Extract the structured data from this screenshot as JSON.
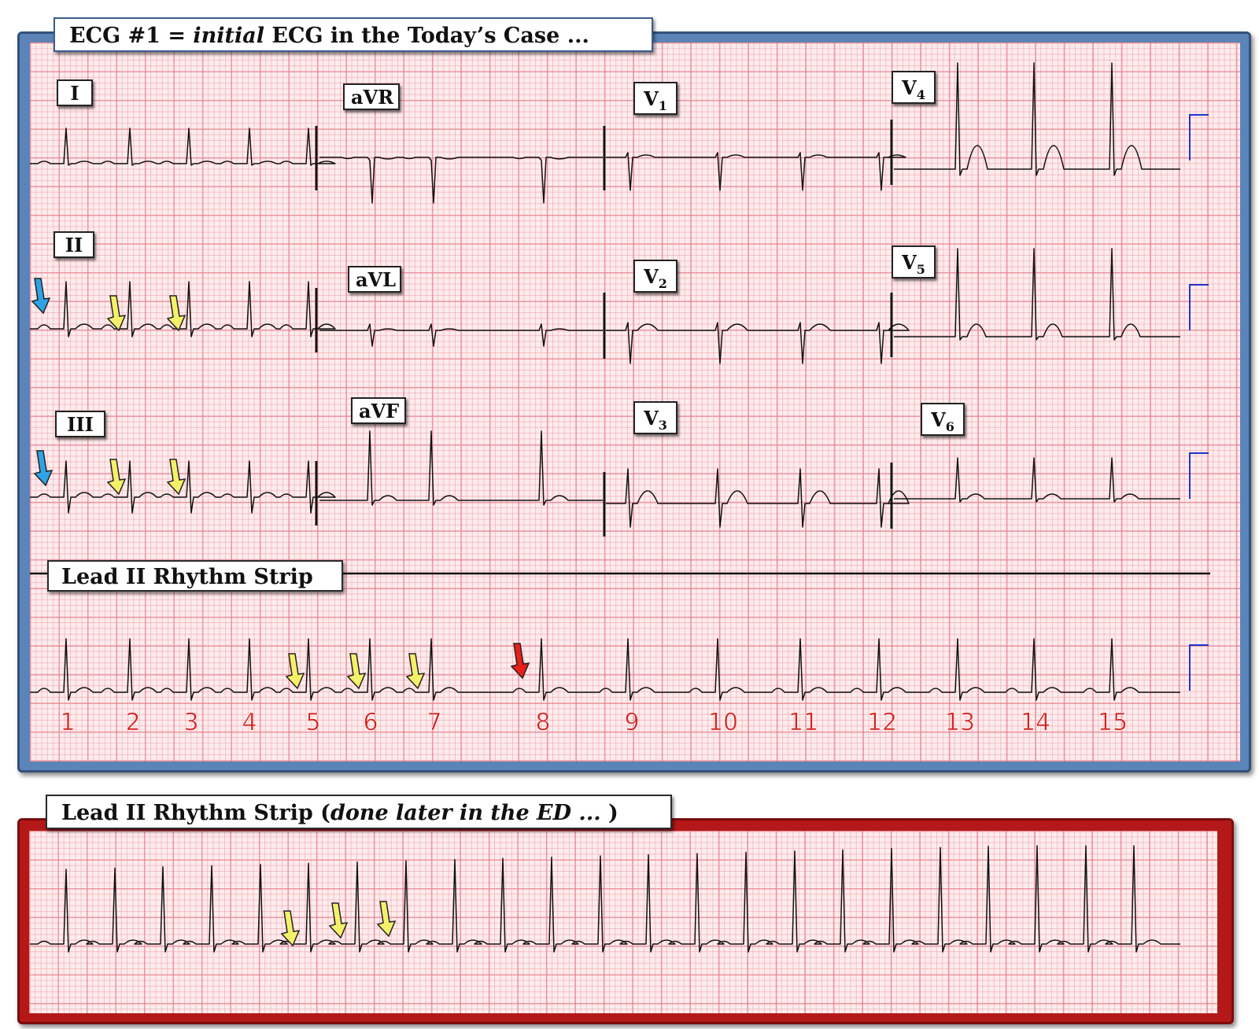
{
  "ecg1_title_prefix": "ECG #1 = ",
  "ecg1_title_italic": "initial",
  "ecg1_title_suffix": " ECG in the Today’s Case ...",
  "leads": {
    "I": "I",
    "II": "II",
    "III": "III",
    "aVR": "aVR",
    "aVL": "aVL",
    "aVF": "aVF",
    "V1_base": "V",
    "V1_sub": "1",
    "V2_base": "V",
    "V2_sub": "2",
    "V3_base": "V",
    "V3_sub": "3",
    "V4_base": "V",
    "V4_sub": "4",
    "V5_base": "V",
    "V5_sub": "5",
    "V6_base": "V",
    "V6_sub": "6"
  },
  "rhythm_strip_label": "Lead II Rhythm Strip",
  "beat_numbers": [
    "1",
    "2",
    "3",
    "4",
    "5",
    "6",
    "7",
    "8",
    "9",
    "10",
    "11",
    "12",
    "13",
    "14",
    "15"
  ],
  "ecg2_title_prefix": "Lead II Rhythm Strip (",
  "ecg2_title_italic": "done later in the ED ...",
  "ecg2_title_suffix": " )",
  "colors": {
    "paper": "#fdeced",
    "ecg1_frame": "#5b84b8",
    "ecg2_frame": "#b41818",
    "arrow_yellow": "#f5f06a",
    "arrow_blue": "#2ea3e6",
    "arrow_red": "#e8201a",
    "beat_number": "#d6201c",
    "calibration": "#2233cc"
  }
}
